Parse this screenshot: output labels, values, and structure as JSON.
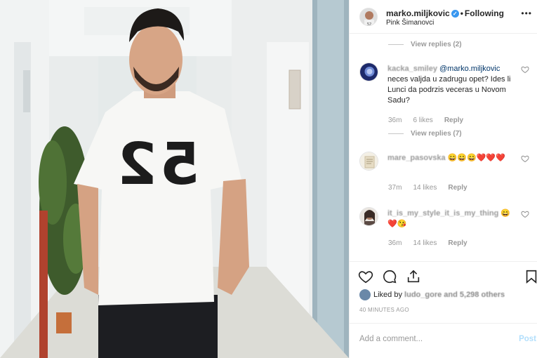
{
  "header": {
    "username": "marko.miljkovic",
    "separator": "•",
    "follow_label": "Following",
    "location": "Pink Šimanovci",
    "more": "•••"
  },
  "photo": {
    "shirt_text": "52"
  },
  "thread": {
    "view_replies_2": "View replies (2)",
    "view_replies_7": "View replies (7)"
  },
  "comments": [
    {
      "user": "kacka_smiley",
      "mention": "@marko.miljkovic",
      "text": " neces valjda u zadrugu opet? Ides li Lunci da podrzis veceras u Novom Sadu?",
      "time": "36m",
      "likes": "6 likes",
      "reply": "Reply"
    },
    {
      "user": "mare_pasovska",
      "mention": "",
      "text": " 😄😄😄❤️❤️❤️",
      "time": "37m",
      "likes": "14 likes",
      "reply": "Reply"
    },
    {
      "user": "it_is_my_style_it_is_my_thing",
      "mention": "",
      "text": " 😄❤️😘",
      "time": "36m",
      "likes": "14 likes",
      "reply": "Reply"
    }
  ],
  "likes": {
    "prefix": "Liked by",
    "user": "ludo_gore",
    "suffix": "and 5,298 others"
  },
  "timestamp": "40 MINUTES AGO",
  "add_comment": {
    "placeholder": "Add a comment...",
    "post_label": "Post"
  },
  "icons": {
    "like": "heart-icon",
    "comment": "comment-icon",
    "share": "share-icon",
    "save": "bookmark-icon",
    "verified": "verified-badge-icon"
  },
  "colors": {
    "link": "#003569",
    "muted": "#999999",
    "verified": "#3897f0",
    "post_disabled": "#b2dffc"
  }
}
